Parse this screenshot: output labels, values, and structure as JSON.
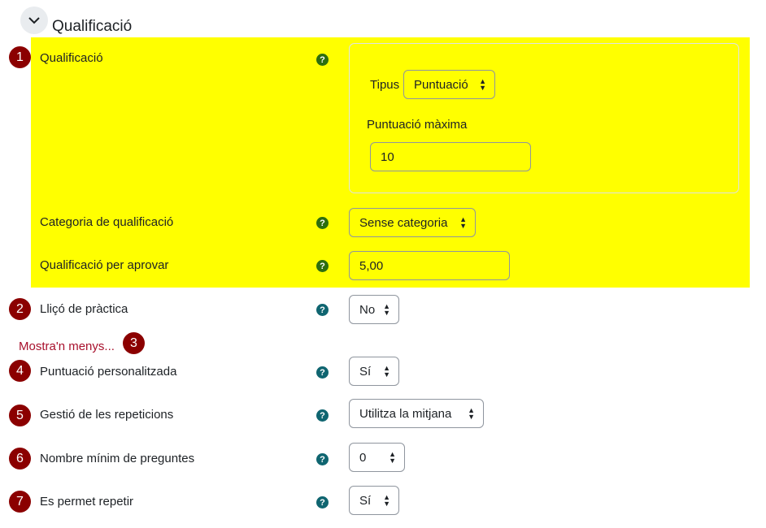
{
  "section": {
    "title": "Qualificació"
  },
  "badges": [
    "1",
    "2",
    "3",
    "4",
    "5",
    "6",
    "7"
  ],
  "help_glyph": "?",
  "colors": {
    "highlight": "#ffff00",
    "badge": "#8b0000",
    "link": "#a8102c",
    "help_green": "#2d6e0f",
    "help_teal": "#0f6570"
  },
  "grade": {
    "label": "Qualificació",
    "type_label": "Tipus",
    "type_value": "Puntuació",
    "max_label": "Puntuació màxima",
    "max_value": "10"
  },
  "grade_category": {
    "label": "Categoria de qualificació",
    "value": "Sense categoria"
  },
  "grade_pass": {
    "label": "Qualificació per aprovar",
    "value": "5,00"
  },
  "practice": {
    "label": "Lliçó de pràctica",
    "value": "No"
  },
  "show_less": {
    "label": "Mostra'n menys..."
  },
  "custom_score": {
    "label": "Puntuació personalitzada",
    "value": "Sí"
  },
  "retake_handling": {
    "label": "Gestió de les repeticions",
    "value": "Utilitza la mitjana"
  },
  "min_questions": {
    "label": "Nombre mínim de preguntes",
    "value": "0"
  },
  "retake": {
    "label": "Es permet repetir",
    "value": "Sí"
  }
}
